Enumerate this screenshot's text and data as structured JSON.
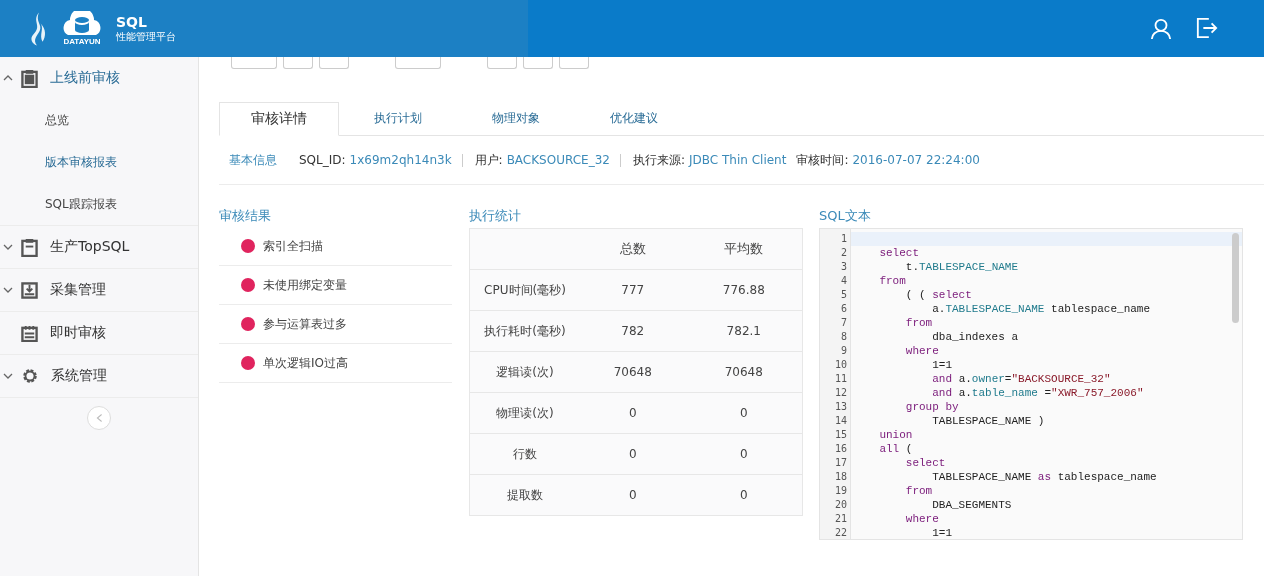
{
  "header": {
    "brand": "DATAYUN",
    "product": "SQL",
    "subtitle": "性能管理平台"
  },
  "sidebar": {
    "groups": [
      {
        "label": "上线前审核",
        "kind": "clipboard",
        "expanded": true,
        "children": [
          {
            "label": "总览",
            "selected": false
          },
          {
            "label": "版本审核报表",
            "selected": true
          },
          {
            "label": "SQL跟踪报表",
            "selected": false
          }
        ]
      },
      {
        "label": "生产TopSQL",
        "kind": "clipboard",
        "expanded": false
      },
      {
        "label": "采集管理",
        "kind": "download",
        "expanded": false
      },
      {
        "label": "即时审核",
        "kind": "calendar"
      },
      {
        "label": "系统管理",
        "kind": "gear",
        "expanded": false
      }
    ]
  },
  "tabs": [
    {
      "label": "审核详情",
      "selected": true
    },
    {
      "label": "执行计划",
      "selected": false
    },
    {
      "label": "物理对象",
      "selected": false
    },
    {
      "label": "优化建议",
      "selected": false
    }
  ],
  "info": {
    "title": "基本信息",
    "fields": [
      {
        "label": "SQL_ID:",
        "value": "1x69m2qh14n3k"
      },
      {
        "label": "用户:",
        "value": "BACKSOURCE_32"
      },
      {
        "label": "执行来源:",
        "value": "JDBC Thin Client"
      },
      {
        "label": "审核时间:",
        "value": "2016-07-07 22:24:00"
      }
    ]
  },
  "results": {
    "title": "审核结果",
    "items": [
      {
        "label": "索引全扫描",
        "color": "#e0245e"
      },
      {
        "label": "未使用绑定变量",
        "color": "#e0245e"
      },
      {
        "label": "参与运算表过多",
        "color": "#e0245e"
      },
      {
        "label": "单次逻辑IO过高",
        "color": "#e0245e"
      }
    ]
  },
  "stats": {
    "title": "执行统计",
    "columns": [
      "总数",
      "平均数"
    ],
    "rows": [
      {
        "name": "CPU时间(毫秒)",
        "total": "777",
        "avg": "776.88"
      },
      {
        "name": "执行耗时(毫秒)",
        "total": "782",
        "avg": "782.1"
      },
      {
        "name": "逻辑读(次)",
        "total": "70648",
        "avg": "70648"
      },
      {
        "name": "物理读(次)",
        "total": "0",
        "avg": "0"
      },
      {
        "name": "行数",
        "total": "0",
        "avg": "0"
      },
      {
        "name": "提取数",
        "total": "0",
        "avg": "0"
      }
    ]
  },
  "sql": {
    "title": "SQL文本",
    "lines": [
      {
        "number": "1",
        "active": true
      },
      {
        "number": "2",
        "active": false,
        "tokens": [
          {
            "text": "    select",
            "kind": "kw"
          }
        ]
      },
      {
        "number": "3",
        "active": false,
        "tokens": [
          {
            "text": "        t."
          },
          {
            "text": "TABLESPACE_NAME",
            "kind": "col"
          }
        ]
      },
      {
        "number": "4",
        "active": false,
        "tokens": [
          {
            "text": "    from",
            "kind": "kw"
          }
        ]
      },
      {
        "number": "5",
        "active": false,
        "tokens": [
          {
            "text": "        ( ( "
          },
          {
            "text": "select",
            "kind": "kw"
          }
        ]
      },
      {
        "number": "6",
        "active": false,
        "tokens": [
          {
            "text": "            a."
          },
          {
            "text": "TABLESPACE_NAME",
            "kind": "col"
          },
          {
            "text": " tablespace_name"
          }
        ]
      },
      {
        "number": "7",
        "active": false,
        "tokens": [
          {
            "text": "        from",
            "kind": "kw"
          }
        ]
      },
      {
        "number": "8",
        "active": false,
        "tokens": [
          {
            "text": "            dba_indexes a"
          }
        ]
      },
      {
        "number": "9",
        "active": false,
        "tokens": [
          {
            "text": "        where",
            "kind": "kw"
          }
        ]
      },
      {
        "number": "10",
        "active": false,
        "tokens": [
          {
            "text": "            1=1"
          }
        ]
      },
      {
        "number": "11",
        "active": false,
        "tokens": [
          {
            "text": "            and",
            "kind": "kw"
          },
          {
            "text": " a."
          },
          {
            "text": "owner",
            "kind": "col"
          },
          {
            "text": "="
          },
          {
            "text": "\"BACKSOURCE_32\"",
            "kind": "str"
          }
        ]
      },
      {
        "number": "12",
        "active": false,
        "tokens": [
          {
            "text": "            and",
            "kind": "kw"
          },
          {
            "text": " a."
          },
          {
            "text": "table_name",
            "kind": "col"
          },
          {
            "text": " ="
          },
          {
            "text": "\"XWR_757_2006\"",
            "kind": "str"
          }
        ]
      },
      {
        "number": "13",
        "active": false,
        "tokens": [
          {
            "text": "        group by",
            "kind": "kw"
          }
        ]
      },
      {
        "number": "14",
        "active": false,
        "tokens": [
          {
            "text": "            TABLESPACE_NAME )"
          }
        ]
      },
      {
        "number": "15",
        "active": false,
        "tokens": [
          {
            "text": "    union",
            "kind": "kw"
          }
        ]
      },
      {
        "number": "16",
        "active": false,
        "tokens": [
          {
            "text": "    all",
            "kind": "kw"
          },
          {
            "text": " ("
          }
        ]
      },
      {
        "number": "17",
        "active": false,
        "tokens": [
          {
            "text": "        select",
            "kind": "kw"
          }
        ]
      },
      {
        "number": "18",
        "active": false,
        "tokens": [
          {
            "text": "            TABLESPACE_NAME "
          },
          {
            "text": "as",
            "kind": "kw"
          },
          {
            "text": " tablespace_name"
          }
        ]
      },
      {
        "number": "19",
        "active": false,
        "tokens": [
          {
            "text": "        from",
            "kind": "kw"
          }
        ]
      },
      {
        "number": "20",
        "active": false,
        "tokens": [
          {
            "text": "            DBA_SEGMENTS"
          }
        ]
      },
      {
        "number": "21",
        "active": false,
        "tokens": [
          {
            "text": "        where",
            "kind": "kw"
          }
        ]
      },
      {
        "number": "22",
        "active": false,
        "tokens": [
          {
            "text": "            1=1"
          }
        ]
      }
    ]
  }
}
